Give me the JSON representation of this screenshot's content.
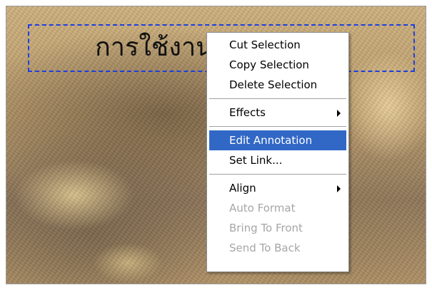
{
  "slide": {
    "title": "การใช้งาน"
  },
  "context_menu": {
    "items": [
      {
        "label": "Cut Selection",
        "enabled": true
      },
      {
        "label": "Copy Selection",
        "enabled": true
      },
      {
        "label": "Delete Selection",
        "enabled": true
      },
      {
        "label": "Effects",
        "enabled": true,
        "submenu": true
      },
      {
        "label": "Edit Annotation",
        "enabled": true,
        "highlighted": true
      },
      {
        "label": "Set Link...",
        "enabled": true
      },
      {
        "label": "Align",
        "enabled": true,
        "submenu": true
      },
      {
        "label": "Auto Format",
        "enabled": false
      },
      {
        "label": "Bring To Front",
        "enabled": false
      },
      {
        "label": "Send To Back",
        "enabled": false
      }
    ]
  },
  "colors": {
    "selection_border": "#1e3ee0",
    "menu_highlight": "#3168c6",
    "disabled_text": "#a6a6a6"
  }
}
